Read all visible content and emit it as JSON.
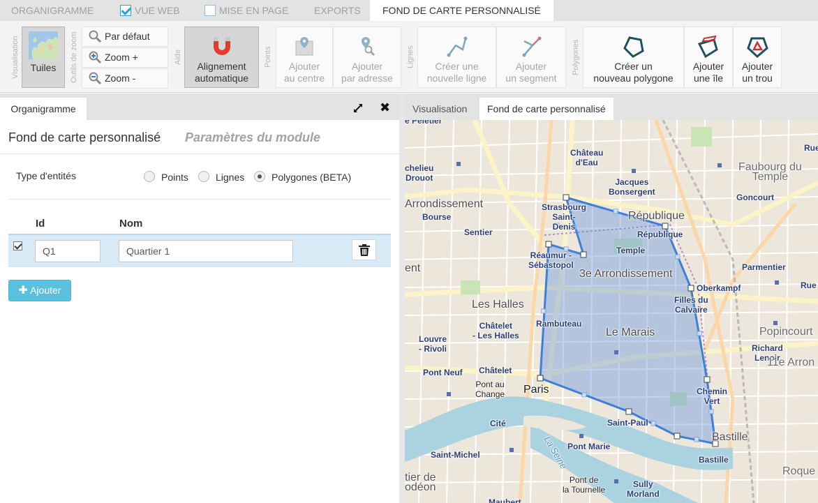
{
  "top_tabs": [
    {
      "label": "ORGANIGRAMME",
      "checkbox": false
    },
    {
      "label": "VUE WEB",
      "checkbox": true,
      "checked": true
    },
    {
      "label": "MISE EN PAGE",
      "checkbox": true,
      "checked": false
    },
    {
      "label": "EXPORTS",
      "checkbox": false
    },
    {
      "label": "FOND DE CARTE PERSONNALISÉ",
      "checkbox": false,
      "active": true
    }
  ],
  "ribbon": {
    "groups": {
      "visualisation": "Visualisation",
      "zoom": "Outils de zoom",
      "aide": "Aide",
      "points": "Points",
      "lignes": "Lignes",
      "polygones": "Polygones"
    },
    "tiles_label": "Tuiles",
    "zoom_default": "Par défaut",
    "zoom_in": "Zoom +",
    "zoom_out": "Zoom -",
    "align_line1": "Alignement",
    "align_line2": "automatique",
    "add_center_line1": "Ajouter",
    "add_center_line2": "au centre",
    "add_address_line1": "Ajouter",
    "add_address_line2": "par adresse",
    "new_line_line1": "Créer une",
    "new_line_line2": "nouvelle ligne",
    "add_segment_line1": "Ajouter",
    "add_segment_line2": "un segment",
    "new_polygon_line1": "Créer un",
    "new_polygon_line2": "nouveau polygone",
    "add_island_line1": "Ajouter",
    "add_island_line2": "une île",
    "add_hole_line1": "Ajouter",
    "add_hole_line2": "un trou"
  },
  "left_panel": {
    "tab": "Organigramme",
    "title": "Fond de carte personnalisé",
    "subtitle": "Paramètres du module",
    "entity_type_label": "Type d'entités",
    "entity_types": [
      {
        "label": "Points",
        "checked": false
      },
      {
        "label": "Lignes",
        "checked": false
      },
      {
        "label": "Polygones (BETA)",
        "checked": true
      }
    ],
    "columns": {
      "id": "Id",
      "name": "Nom"
    },
    "rows": [
      {
        "id": "Q1",
        "name": "Quartier 1",
        "selected": true
      }
    ],
    "add_button": "Ajouter"
  },
  "right_panel": {
    "tabs": [
      {
        "label": "Visualisation",
        "active": false
      },
      {
        "label": "Fond de carte personnalisé",
        "active": true
      }
    ]
  },
  "map": {
    "polygon_color": "#3d7fd9",
    "labels": {
      "pelletier": "e Peletier",
      "chateau_deau": "Château\nd'Eau",
      "faubourg_temple": "Faubourg du\nTemple",
      "goncourt": "Goncourt",
      "jacques_bonsergent": "Jacques\nBonsergent",
      "richelieu_drouot": "chelieu\nDrouot",
      "arrondissement_left": "Arrondissement",
      "bourse": "Bourse",
      "sentier": "Sentier",
      "strasbourg": "Strasbourg\nSaint-\nDenis",
      "republique_big": "République",
      "republique": "République",
      "reaumur": "Réaumur -\nSébastopol",
      "temple": "Temple",
      "ent": "ent",
      "arr3": "3e Arrondissement",
      "parmentier": "Parmentier",
      "oberkampf": "Oberkampf",
      "rue_right": "Rue",
      "filles_calvaire": "Filles du\nCalvaire",
      "les_halles": "Les Halles",
      "rambuteau": "Rambuteau",
      "le_marais": "Le Marais",
      "chatelet_les_halles": "Châtelet\n- Les Halles",
      "louvre_rivoli": "Louvre\n- Rivoli",
      "popincourt": "Popincourt",
      "richard_lenoir": "Richard\nLenoir",
      "arr11": "11e Arron",
      "pont_neuf": "Pont Neuf",
      "chatelet": "Châtelet",
      "pont_au_change": "Pont au\nChange",
      "paris": "Paris",
      "chemin_vert": "Chemin\nVert",
      "saint_paul": "Saint-Paul",
      "cite": "Cité",
      "bastille_big": "Bastille",
      "pont_marie": "Pont Marie",
      "bastille": "Bastille",
      "saint_michel": "Saint-Michel",
      "la_seine": "La Seine",
      "roquette": "Roque",
      "tier_de": "tier de\nodéon",
      "pont_tournelle": "Pont de\nla Tournelle",
      "sully_morland": "Sully\nMorland",
      "maubert": "Maubert",
      "rue_top": "Rue"
    }
  }
}
